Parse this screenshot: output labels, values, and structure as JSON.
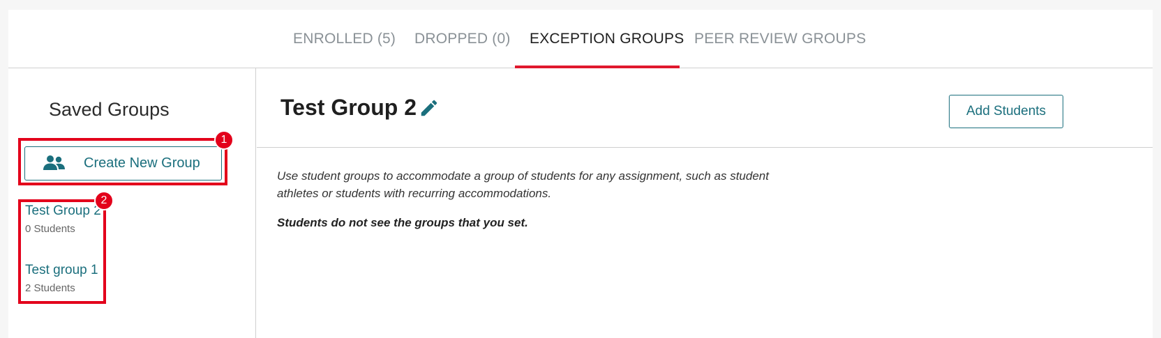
{
  "tabs": [
    {
      "label": "ENROLLED (5)"
    },
    {
      "label": "DROPPED (0)"
    },
    {
      "label": "EXCEPTION GROUPS"
    },
    {
      "label": "PEER REVIEW GROUPS"
    }
  ],
  "active_tab": "EXCEPTION GROUPS",
  "sidebar": {
    "title": "Saved Groups",
    "create_button": {
      "label": "Create New Group",
      "icon": "people-icon"
    },
    "groups": [
      {
        "name": "Test Group 2",
        "count": "0 Students"
      },
      {
        "name": "Test group 1",
        "count": "2 Students"
      }
    ]
  },
  "main": {
    "title": "Test Group 2",
    "edit_icon": "pencil-icon",
    "add_button": "Add Students",
    "description": "Use student groups to accommodate a group of students for any assignment, such as student athletes or students with recurring accommodations.",
    "note": "Students do not see the groups that you set."
  },
  "annotations": [
    {
      "badge": "1"
    },
    {
      "badge": "2"
    }
  ],
  "colors": {
    "accent": "#1b6f7d",
    "tab_underline": "#e0182d",
    "annotation": "#e3001b"
  }
}
